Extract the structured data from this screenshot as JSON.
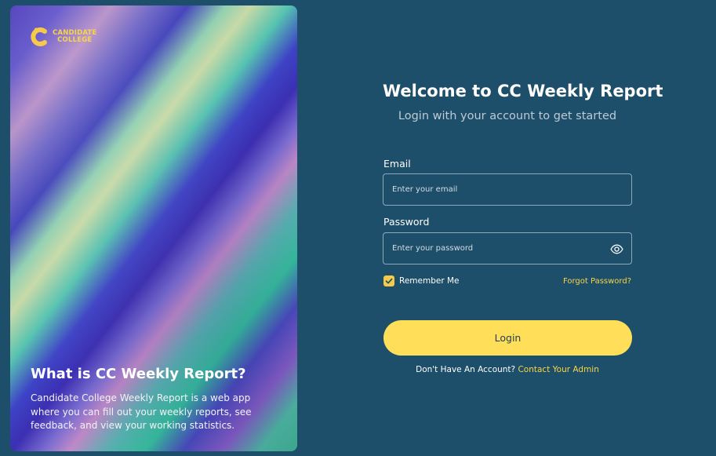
{
  "brand": {
    "logo_line1": "CANDIDATE",
    "logo_line2": "COLLEGE",
    "accent_color": "#f7d448"
  },
  "hero": {
    "title": "What is CC Weekly Report?",
    "description": "Candidate College Weekly Report is a web app where you can fill out your weekly reports, see feedback, and view your working statistics."
  },
  "login": {
    "title": "Welcome to CC Weekly Report",
    "subtitle": "Login with your account to get started",
    "email_label": "Email",
    "email_placeholder": "Enter your email",
    "email_value": "",
    "password_label": "Password",
    "password_placeholder": "Enter your password",
    "password_value": "",
    "remember_label": "Remember Me",
    "remember_checked": true,
    "forgot_label": "Forgot Password?",
    "login_button": "Login",
    "no_account_text": "Don't Have An Account?",
    "contact_label": "Contact Your Admin",
    "icons": {
      "password_toggle": "eye-icon",
      "remember": "checkmark-icon"
    }
  },
  "colors": {
    "background": "#1d4e6a",
    "button": "#ffde59",
    "link": "#f7d448"
  }
}
